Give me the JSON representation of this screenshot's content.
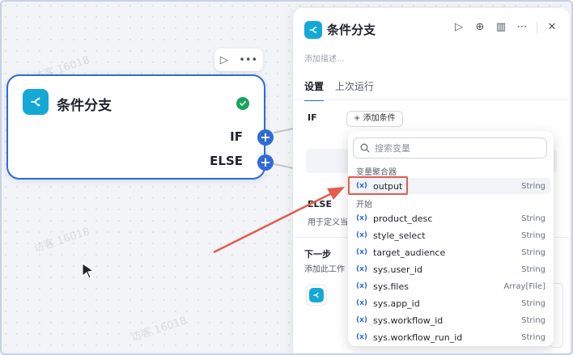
{
  "watermark": {
    "text": "访客 16018"
  },
  "node": {
    "title": "条件分支",
    "ports": {
      "if": "IF",
      "else": "ELSE"
    }
  },
  "panel": {
    "title": "条件分支",
    "description_placeholder": "添加描述...",
    "tabs": [
      {
        "label": "设置",
        "active": true
      },
      {
        "label": "上次运行",
        "active": false
      }
    ],
    "if_label": "IF",
    "add_condition": "添加条件",
    "else_label": "ELSE",
    "else_desc": "用于定义当",
    "next_step_label": "下一步",
    "next_step_desc": "添加此工作"
  },
  "dropdown": {
    "search_placeholder": "搜索变量",
    "groups": [
      {
        "label": "变量聚合器",
        "items": [
          {
            "name": "output",
            "type": "String"
          }
        ]
      },
      {
        "label": "开始",
        "items": [
          {
            "name": "product_desc",
            "type": "String"
          },
          {
            "name": "style_select",
            "type": "String"
          },
          {
            "name": "target_audience",
            "type": "String"
          },
          {
            "name": "sys.user_id",
            "type": "String"
          },
          {
            "name": "sys.files",
            "type": "Array[File]"
          },
          {
            "name": "sys.app_id",
            "type": "String"
          },
          {
            "name": "sys.workflow_id",
            "type": "String"
          },
          {
            "name": "sys.workflow_run_id",
            "type": "String"
          }
        ]
      }
    ],
    "var_marker": "(x)"
  },
  "colors": {
    "accent": "#2f6bd8",
    "node_icon": "#14a8d6",
    "success": "#1aa35b",
    "annotation": "#e55a4e"
  }
}
